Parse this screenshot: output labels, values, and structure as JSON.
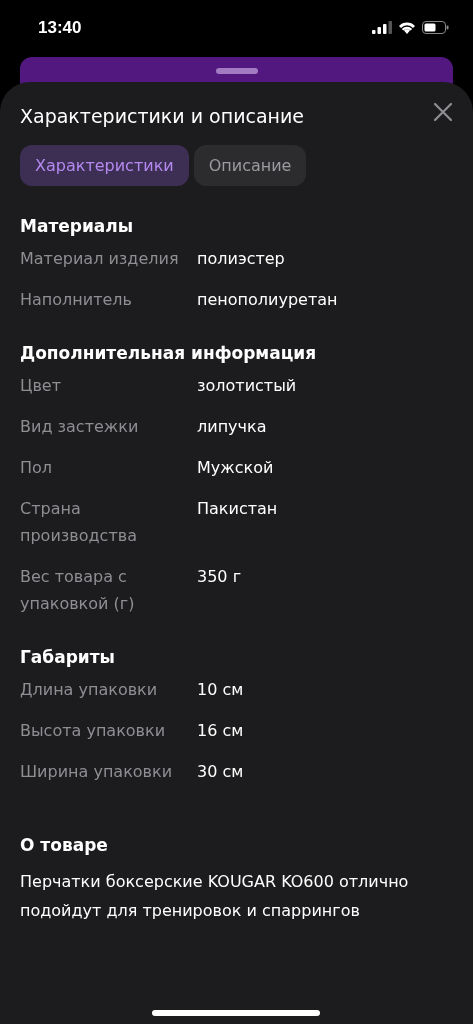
{
  "status_bar": {
    "time": "13:40"
  },
  "sheet": {
    "title": "Характеристики и описание"
  },
  "tabs": [
    {
      "label": "Характеристики",
      "selected": true
    },
    {
      "label": "Описание",
      "selected": false
    }
  ],
  "sections": [
    {
      "title": "Материалы",
      "rows": [
        {
          "label": "Материал изделия",
          "value": "полиэстер"
        },
        {
          "label": "Наполнитель",
          "value": "пенополиуретан"
        }
      ]
    },
    {
      "title": "Дополнительная информация",
      "rows": [
        {
          "label": "Цвет",
          "value": "золотистый"
        },
        {
          "label": "Вид застежки",
          "value": "липучка"
        },
        {
          "label": "Пол",
          "value": "Мужской"
        },
        {
          "label": "Страна производства",
          "value": "Пакистан"
        },
        {
          "label": "Вес товара с упаковкой (г)",
          "value": "350 г"
        }
      ]
    },
    {
      "title": "Габариты",
      "rows": [
        {
          "label": "Длина упаковки",
          "value": "10 см"
        },
        {
          "label": "Высота упаковки",
          "value": "16 см"
        },
        {
          "label": "Ширина упаковки",
          "value": "30 см"
        }
      ]
    }
  ],
  "about": {
    "title": "О товаре",
    "text": "Перчатки боксерские KOUGAR KO600 отлично подойдут для тренировок и спаррингов"
  }
}
